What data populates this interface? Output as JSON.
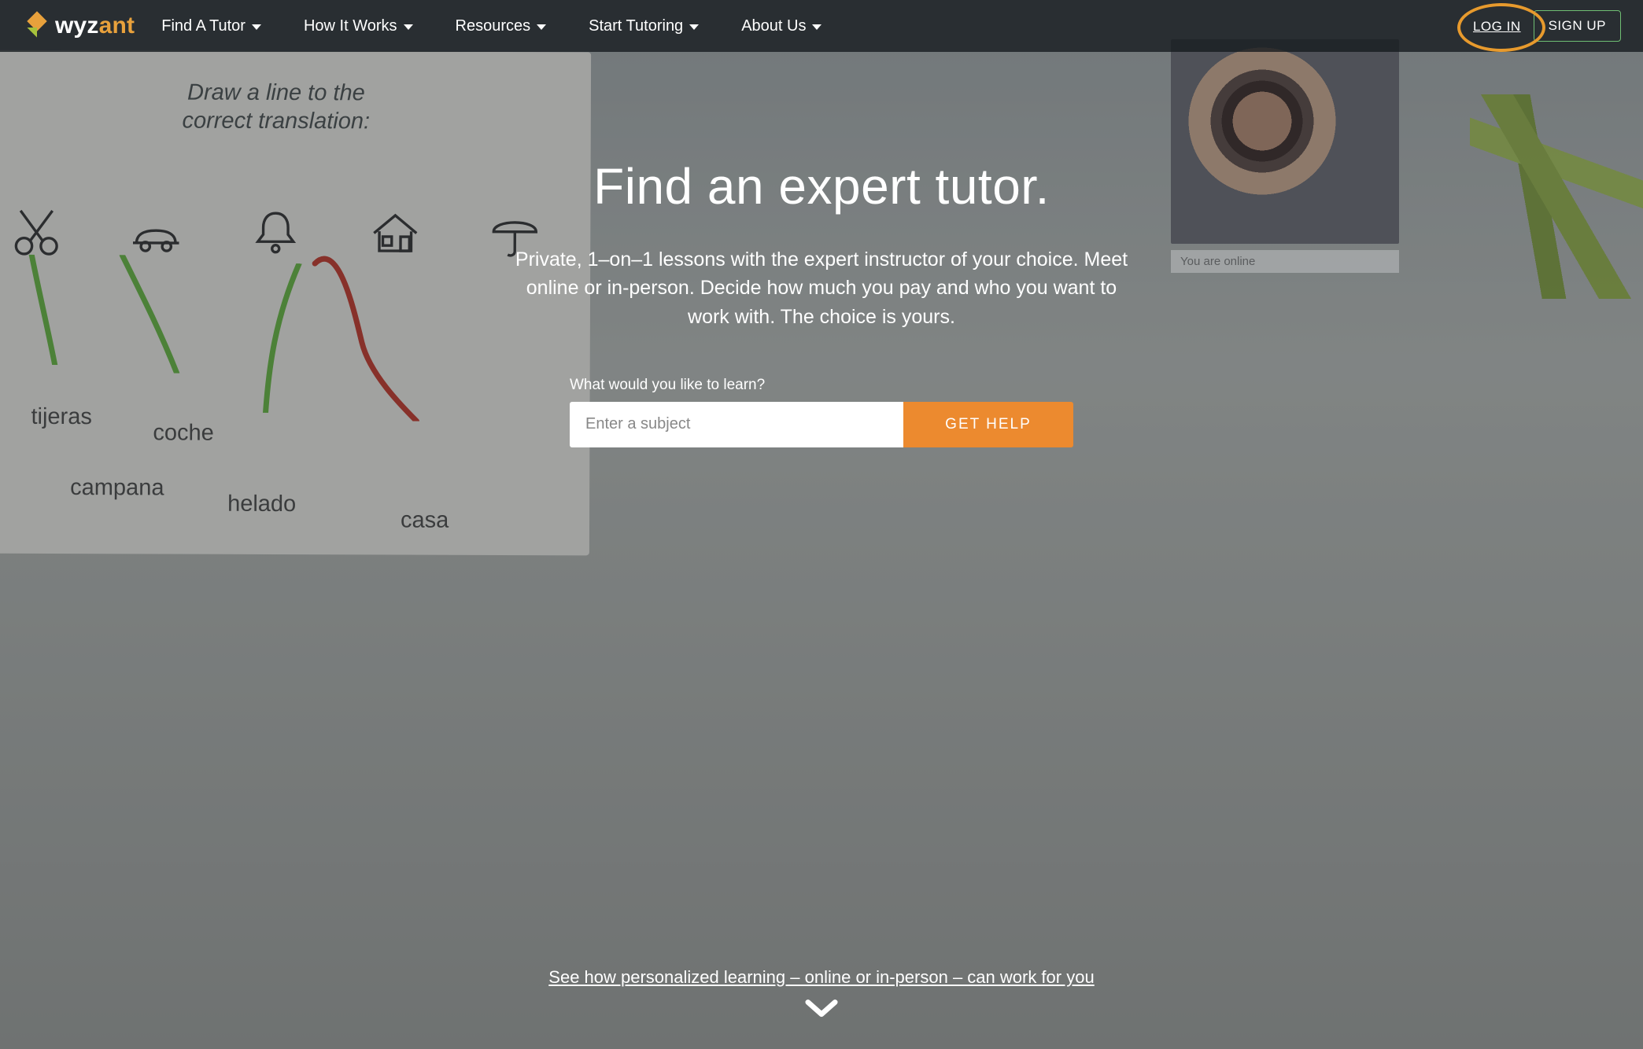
{
  "brand": {
    "name_part1": "wyz",
    "name_part2": "ant"
  },
  "nav": {
    "items": [
      {
        "label": "Find A Tutor",
        "has_dropdown": true
      },
      {
        "label": "How It Works",
        "has_dropdown": true
      },
      {
        "label": "Resources",
        "has_dropdown": true
      },
      {
        "label": "Start Tutoring",
        "has_dropdown": true
      },
      {
        "label": "About Us",
        "has_dropdown": true
      }
    ],
    "login": "LOG IN",
    "signup": "SIGN UP"
  },
  "hero": {
    "title": "Find an expert tutor.",
    "subtitle": "Private, 1–on–1 lessons with the expert instructor of your choice. Meet online or in-person. Decide how much you pay and who you want to work with. The choice is yours.",
    "search_label": "What would you like to learn?",
    "search_placeholder": "Enter a subject",
    "cta": "GET HELP",
    "learn_more": "See how personalized learning – online or in-person – can work for you"
  },
  "bg_whiteboard": {
    "prompt_line1": "Draw a line to the",
    "prompt_line2": "correct translation:",
    "words": {
      "tijeras": "tijeras",
      "ras1": "as",
      "ras2": "ras",
      "coche": "coche",
      "campana": "campana",
      "helado": "helado",
      "casa": "casa"
    }
  },
  "status_you_are_online": "You are online",
  "colors": {
    "accent_orange": "#ec8a2f",
    "accent_green": "#6fbf73",
    "highlight_ring": "#e79a2d"
  },
  "annotation": {
    "login_circled": true
  }
}
